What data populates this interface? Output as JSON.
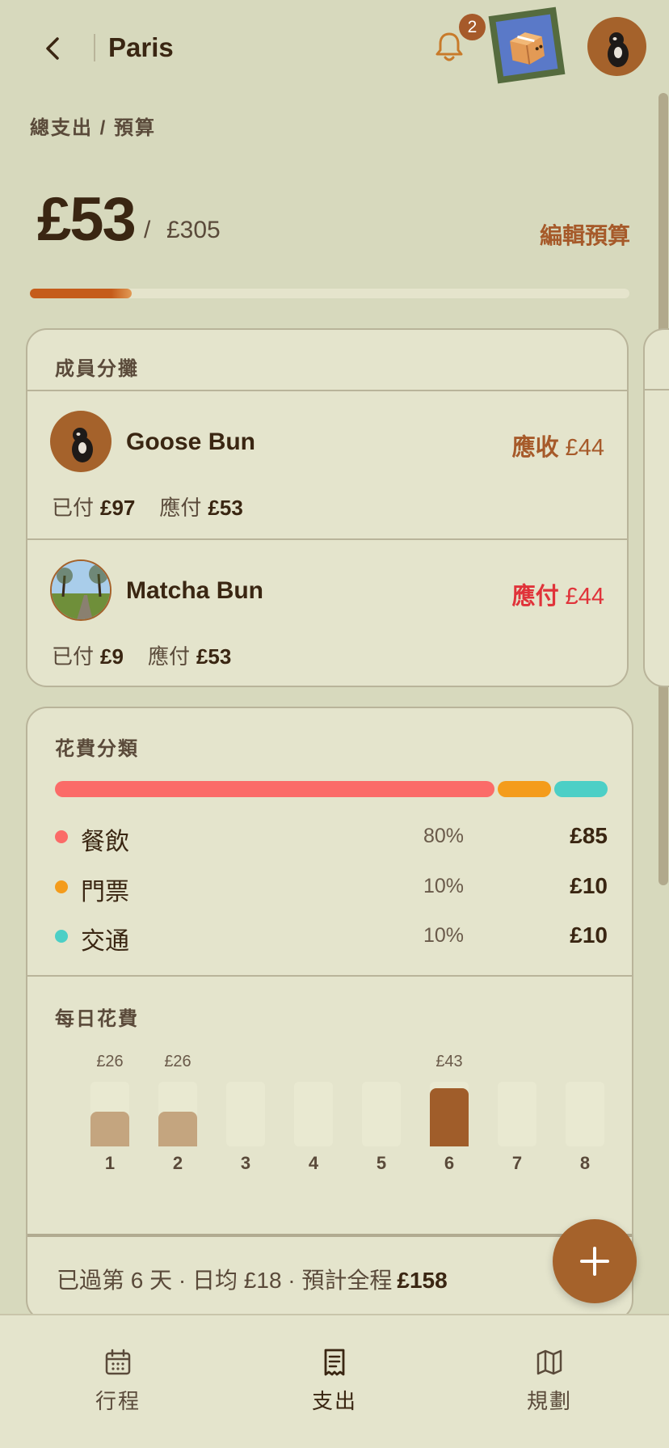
{
  "header": {
    "city": "Paris",
    "notification_count": "2"
  },
  "overview": {
    "breadcrumb": "總支出 / 預算",
    "spent": "£53",
    "separator": "/",
    "budget": "£305",
    "edit_budget_label": "編輯預算",
    "progress": 0.17
  },
  "members_card": {
    "title": "成員分攤",
    "paid_label": "已付",
    "owed_label": "應付",
    "members": [
      {
        "name": "Goose Bun",
        "status_label": "應收",
        "status_amount": "£44",
        "status_color": "#a65a2a",
        "paid": "£97",
        "owed": "£53"
      },
      {
        "name": "Matcha Bun",
        "status_label": "應付",
        "status_amount": "£44",
        "status_color": "#e0333a",
        "paid": "£9",
        "owed": "£53"
      }
    ]
  },
  "categories_card": {
    "title": "花費分類",
    "items": [
      {
        "name": "餐飲",
        "percent": "80%",
        "amount": "£85",
        "color": "#fb6b68"
      },
      {
        "name": "門票",
        "percent": "10%",
        "amount": "£10",
        "color": "#f49c1c"
      },
      {
        "name": "交通",
        "percent": "10%",
        "amount": "£10",
        "color": "#4ccfc6"
      }
    ]
  },
  "daily_card": {
    "title": "每日花費",
    "summary_text": "已過第 6 天 · 日均 £18 · 預計全程",
    "summary_total": "£158"
  },
  "chart_data": {
    "type": "bar",
    "categories": [
      "1",
      "2",
      "3",
      "4",
      "5",
      "6",
      "7",
      "8"
    ],
    "values": [
      26,
      26,
      0,
      0,
      0,
      43,
      0,
      0
    ],
    "value_labels": [
      "£26",
      "£26",
      "",
      "",
      "",
      "£43",
      "",
      ""
    ],
    "highlight_index": 5,
    "colors": {
      "normal": "#c4a57f",
      "highlight": "#a05d2a",
      "empty": "#e9e9d1"
    }
  },
  "tabs": [
    {
      "label": "行程",
      "icon": "calendar-icon"
    },
    {
      "label": "支出",
      "icon": "receipt-icon"
    },
    {
      "label": "規劃",
      "icon": "map-icon"
    }
  ],
  "colors": {
    "background": "#d7d9bd",
    "card": "#e4e4cc",
    "accent": "#a65a2a"
  }
}
